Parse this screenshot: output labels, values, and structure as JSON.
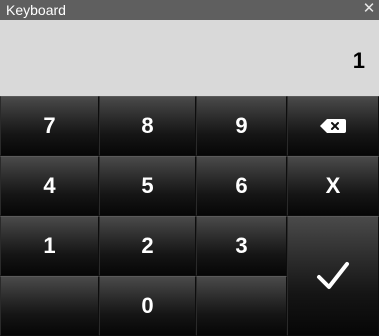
{
  "window": {
    "title": "Keyboard",
    "close_glyph": "✕"
  },
  "display": {
    "value": "1"
  },
  "keys": {
    "k7": "7",
    "k8": "8",
    "k9": "9",
    "k4": "4",
    "k5": "5",
    "k6": "6",
    "k1": "1",
    "k2": "2",
    "k3": "3",
    "k0": "0",
    "clear": "X",
    "backspace_icon": "backspace-icon",
    "enter_icon": "checkmark-icon"
  },
  "colors": {
    "titlebar": "#5f5f5f",
    "display_bg": "#d9d9d9",
    "key_top": "#4a4a4a",
    "key_bottom": "#060606",
    "key_text": "#ffffff"
  }
}
